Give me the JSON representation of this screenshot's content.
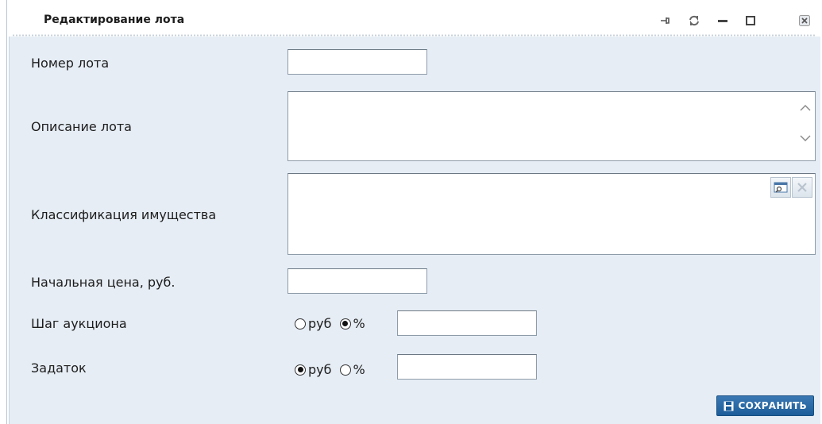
{
  "window": {
    "title": "Редактирование лота",
    "controls": [
      "pin-icon",
      "refresh-icon",
      "minimize-icon",
      "maximize-icon",
      "close-icon"
    ]
  },
  "form": {
    "lot_number": {
      "label": "Номер лота",
      "value": ""
    },
    "lot_description": {
      "label": "Описание лота",
      "value": ""
    },
    "property_classification": {
      "label": "Классификация имущества",
      "value": "",
      "buttons": [
        "select-icon",
        "clear-icon"
      ]
    },
    "start_price": {
      "label": "Начальная цена, руб.",
      "value": ""
    },
    "auction_step": {
      "label": "Шаг аукциона",
      "option_rub": "руб",
      "option_percent": "%",
      "selected": "percent",
      "value": ""
    },
    "deposit": {
      "label": "Задаток",
      "option_rub": "руб",
      "option_percent": "%",
      "selected": "rub",
      "value": ""
    }
  },
  "actions": {
    "save_label": "СОХРАНИТЬ"
  },
  "colors": {
    "content_bg": "#e6edf5",
    "save_button": "#1f609c"
  }
}
